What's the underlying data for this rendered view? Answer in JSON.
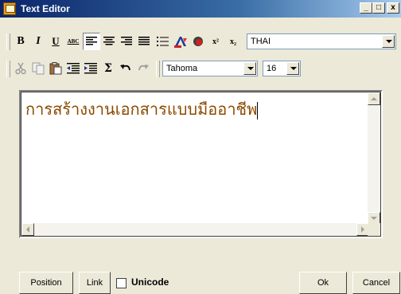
{
  "window": {
    "title": "Text Editor",
    "controls": [
      "_",
      "□",
      "x"
    ]
  },
  "toolbar1": {
    "bold": "B",
    "italic": "I",
    "underline": "U",
    "spell": "ABC",
    "superscript": "x²",
    "subscript": "x₂",
    "language": "THAI",
    "active_alignment": "align-left"
  },
  "toolbar2": {
    "sigma": "Σ",
    "font_family": "Tahoma",
    "font_size": "16"
  },
  "editor": {
    "content": "การสร้างงานเอกสารแบบมืออาชีพ"
  },
  "footer": {
    "position_label": "Position",
    "link_label": "Link",
    "unicode_label": "Unicode",
    "unicode_checked": false,
    "ok_label": "Ok",
    "cancel_label": "Cancel"
  }
}
